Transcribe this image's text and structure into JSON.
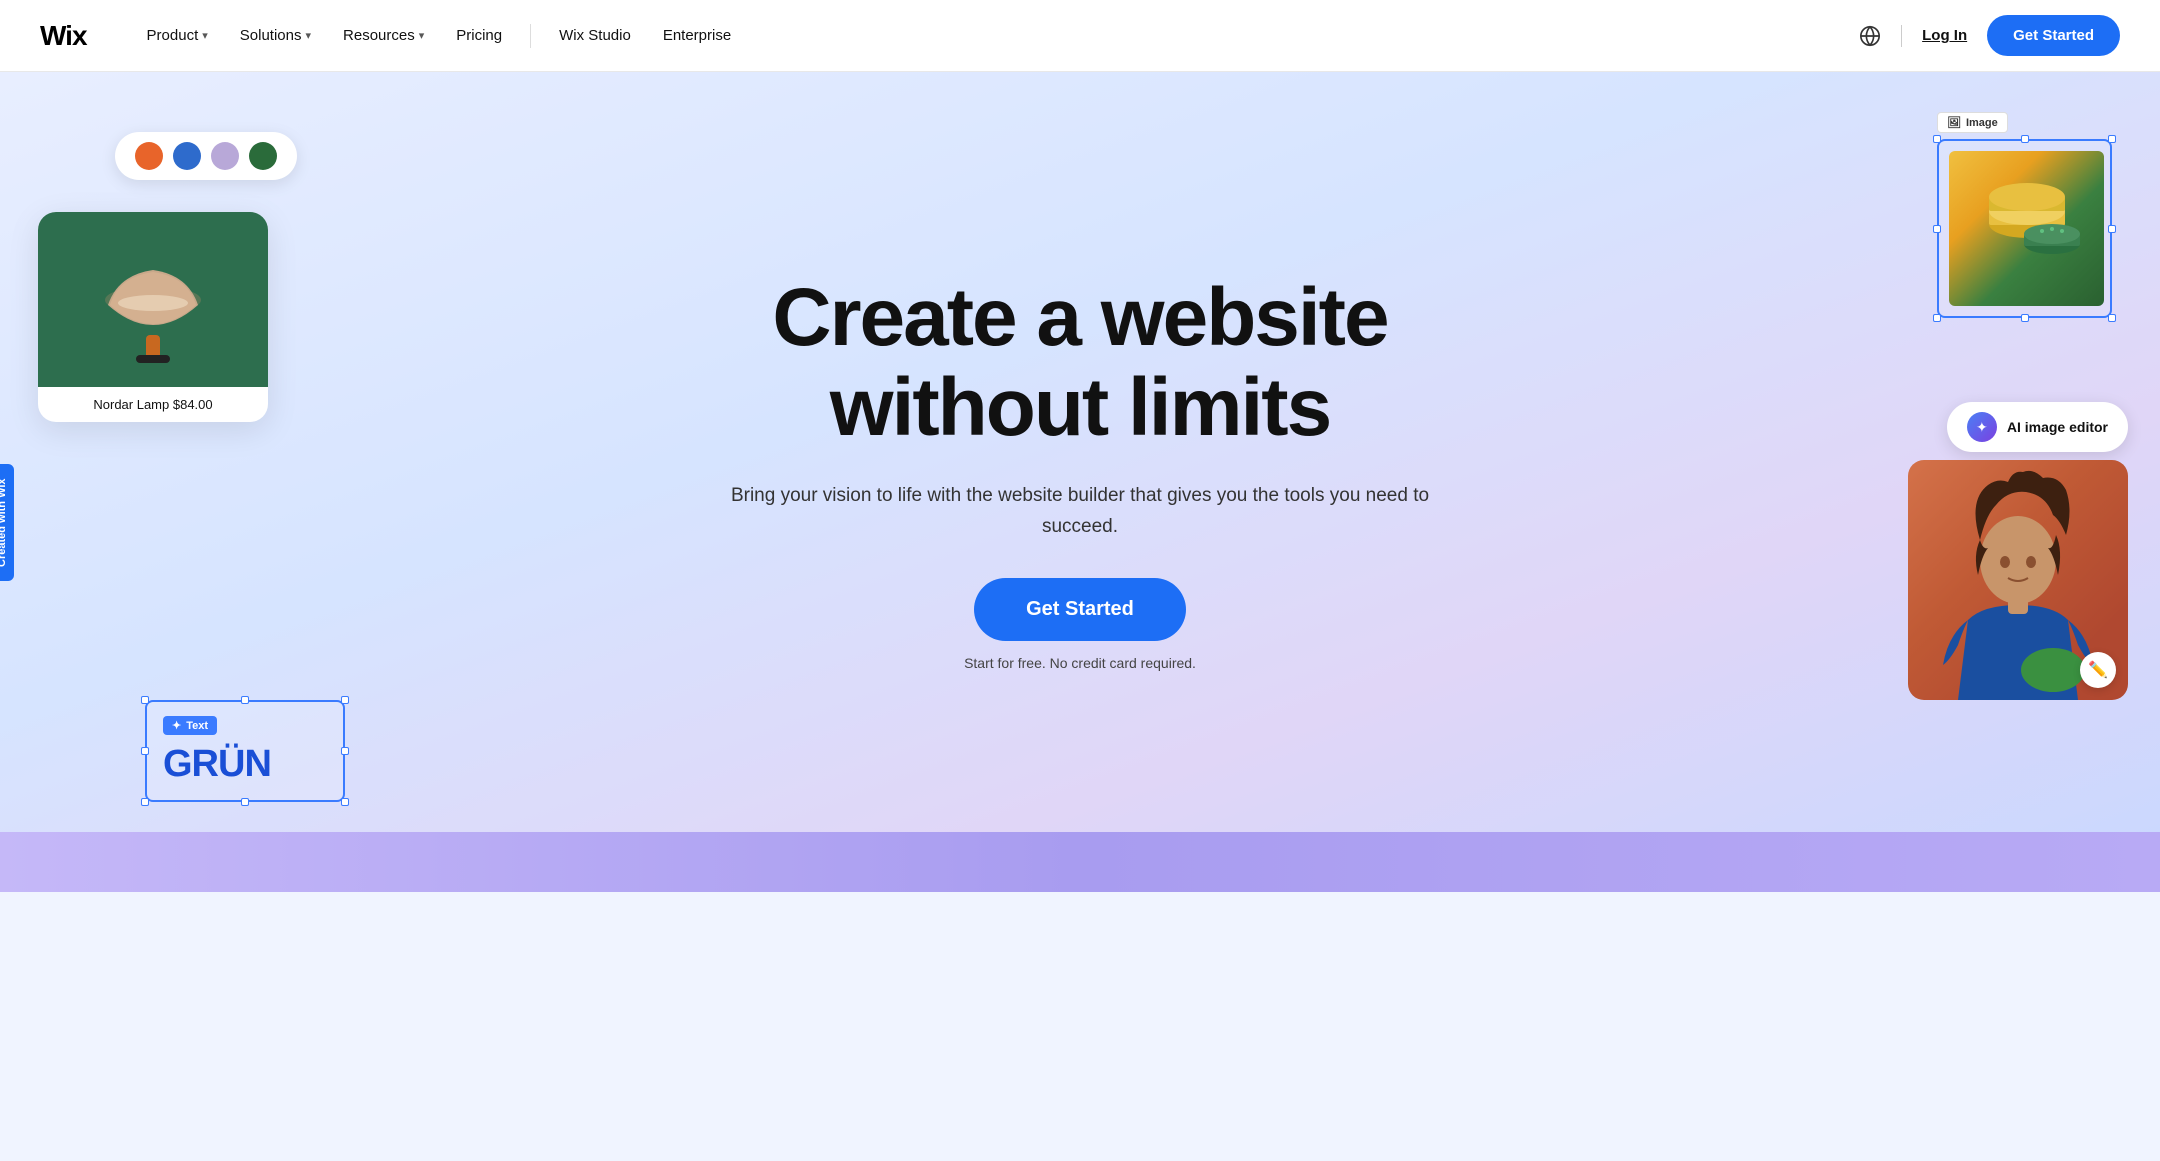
{
  "navbar": {
    "logo": "Wix",
    "nav_items": [
      {
        "label": "Product",
        "has_dropdown": true
      },
      {
        "label": "Solutions",
        "has_dropdown": true
      },
      {
        "label": "Resources",
        "has_dropdown": true
      },
      {
        "label": "Pricing",
        "has_dropdown": false
      },
      {
        "label": "Wix Studio",
        "has_dropdown": false
      },
      {
        "label": "Enterprise",
        "has_dropdown": false
      }
    ],
    "login_label": "Log In",
    "get_started_label": "Get Started"
  },
  "hero": {
    "title_line1": "Create a website",
    "title_line2": "without limits",
    "subtitle": "Bring your vision to life with the website builder that\ngives you the tools you need to succeed.",
    "cta_button": "Get Started",
    "cta_note": "Start for free. No credit card required."
  },
  "lamp_card": {
    "label": "Nordar Lamp $84.00"
  },
  "swatches": [
    {
      "color": "#e8642a"
    },
    {
      "color": "#2e6bcc"
    },
    {
      "color": "#b8a8d8"
    },
    {
      "color": "#2a6b3a"
    }
  ],
  "text_card": {
    "badge": "Text",
    "logo_text": "GRÜN"
  },
  "image_card": {
    "badge": "Image"
  },
  "ai_editor": {
    "label": "AI image editor"
  },
  "created_badge": "Created with Wix",
  "icons": {
    "globe": "🌐",
    "ai_star": "✦",
    "pencil": "✏️",
    "text_cursor": "T"
  }
}
